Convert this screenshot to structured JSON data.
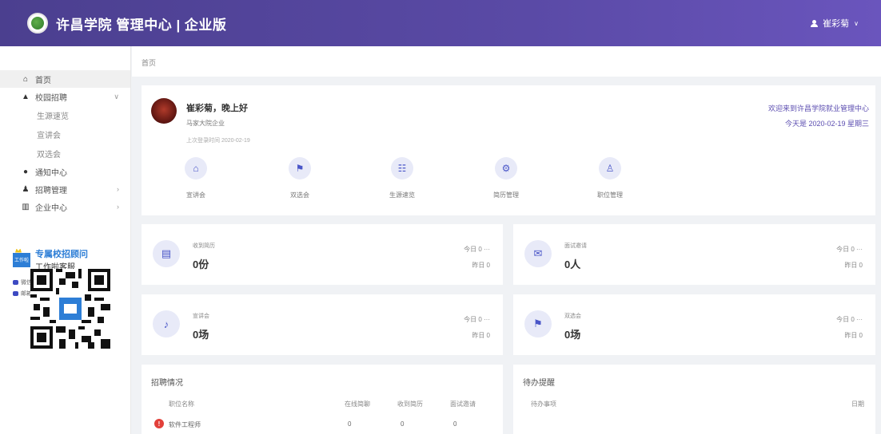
{
  "header": {
    "title": "许昌学院 管理中心 | 企业版",
    "user_name": "崔彩菊",
    "user_chevron": "∨"
  },
  "sidebar": {
    "items": [
      {
        "label": "首页",
        "icon": "home-icon"
      },
      {
        "label": "校园招聘",
        "icon": "graduation-cap-icon"
      },
      {
        "label": "生源速览"
      },
      {
        "label": "宣讲会"
      },
      {
        "label": "双选会"
      },
      {
        "label": "通知中心",
        "icon": "message-icon"
      },
      {
        "label": "招聘管理",
        "icon": "users-icon"
      },
      {
        "label": "企业中心",
        "icon": "building-icon"
      }
    ],
    "promo": {
      "logo_text": "工作啦",
      "title": "专属校招顾问",
      "subtitle": "工作啦客服",
      "wechat": "微信：goworkla1",
      "email": "邮箱：service@goworkla"
    }
  },
  "breadcrumb": {
    "current": "首页"
  },
  "welcome": {
    "greeting": "崔彩菊，晚上好",
    "company": "马家大院企业",
    "last_login": "上次登录时间 2020-02-19",
    "welcome_text": "欢迎来到许昌学院就业管理中心",
    "today": "今天是 2020-02-19  星期三",
    "quick_links": [
      {
        "label": "宣讲会",
        "icon": "building-icon"
      },
      {
        "label": "双选会",
        "icon": "flag-icon"
      },
      {
        "label": "生源速览",
        "icon": "group-icon"
      },
      {
        "label": "简历管理",
        "icon": "gear-icon"
      },
      {
        "label": "职位管理",
        "icon": "user-tie-icon"
      }
    ]
  },
  "stats": [
    {
      "label": "收到简历",
      "value": "0份",
      "today": "今日 0 ···",
      "yesterday": "昨日 0",
      "icon": "resume-icon"
    },
    {
      "label": "面试邀请",
      "value": "0人",
      "today": "今日 0 ···",
      "yesterday": "昨日 0",
      "icon": "envelope-icon"
    },
    {
      "label": "宣讲会",
      "value": "0场",
      "today": "今日 0 ···",
      "yesterday": "昨日 0",
      "icon": "microphone-icon"
    },
    {
      "label": "双选会",
      "value": "0场",
      "today": "今日 0 ···",
      "yesterday": "昨日 0",
      "icon": "flag-icon"
    }
  ],
  "recruit": {
    "title": "招聘情况",
    "columns": [
      "职位名称",
      "在线简聊",
      "收到简历",
      "面试邀请"
    ],
    "rows": [
      {
        "name": "软件工程师",
        "c1": "0",
        "c2": "0",
        "c3": "0",
        "badge": "!"
      }
    ]
  },
  "todo": {
    "title": "待办提醒",
    "columns": [
      "待办事项",
      "日期"
    ]
  },
  "colors": {
    "header_start": "#4b3f8f",
    "header_end": "#6a55bd",
    "icon_blue": "#4a56c8",
    "icon_bg": "#e8eaf8",
    "warn": "#e2403a"
  }
}
